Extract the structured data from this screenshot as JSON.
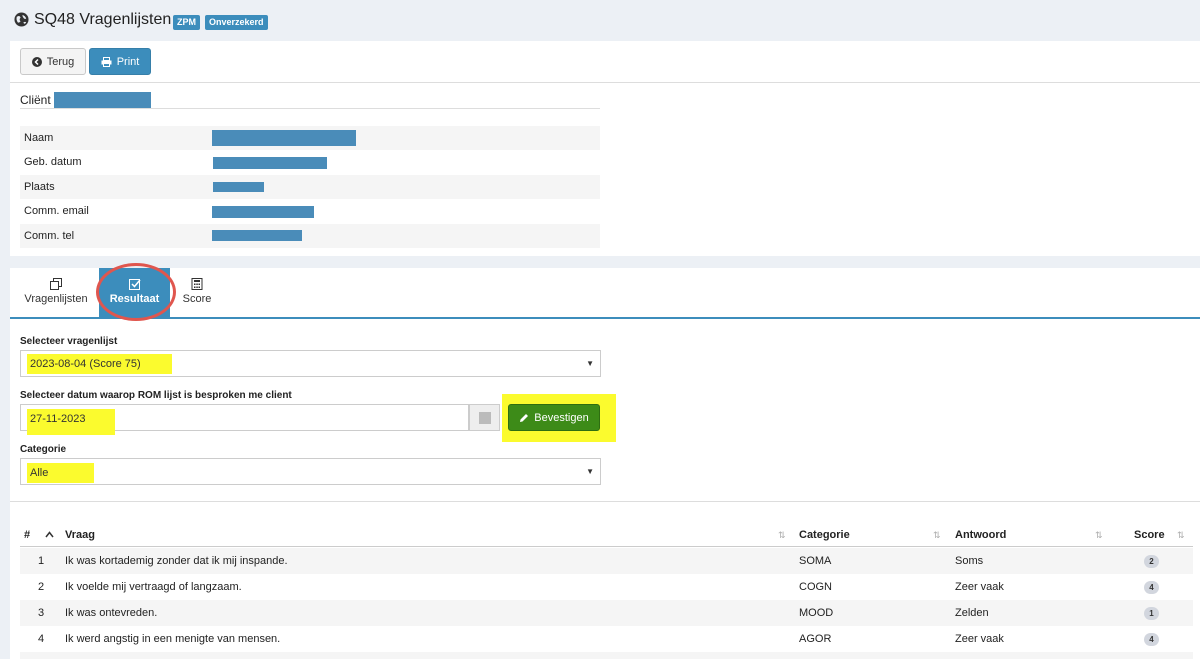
{
  "header": {
    "icon": "globe-icon",
    "title": "SQ48 Vragenlijsten",
    "badges": [
      "ZPM",
      "Onverzekerd"
    ]
  },
  "toolbar": {
    "back_label": "Terug",
    "print_label": "Print"
  },
  "client": {
    "section_label": "Cliënt",
    "fields": [
      {
        "label": "Naam"
      },
      {
        "label": "Geb. datum"
      },
      {
        "label": "Plaats"
      },
      {
        "label": "Comm. email"
      },
      {
        "label": "Comm. tel"
      }
    ]
  },
  "tabs": [
    {
      "label": "Vragenlijsten",
      "icon": "copy-icon"
    },
    {
      "label": "Resultaat",
      "icon": "check-square-icon",
      "active": true
    },
    {
      "label": "Score",
      "icon": "calculator-icon"
    }
  ],
  "form": {
    "questionnaire_label": "Selecteer vragenlijst",
    "questionnaire_value": "2023-08-04 (Score 75)",
    "date_label": "Selecteer datum waarop ROM lijst is besproken me client",
    "date_value": "27-11-2023",
    "confirm_label": "Bevestigen",
    "category_label": "Categorie",
    "category_value": "Alle"
  },
  "table": {
    "headers": [
      "#",
      "Vraag",
      "Categorie",
      "Antwoord",
      "Score"
    ],
    "rows": [
      {
        "num": "1",
        "question": "Ik was kortademig zonder dat ik mij inspande.",
        "category": "SOMA",
        "answer": "Soms",
        "score": "2"
      },
      {
        "num": "2",
        "question": "Ik voelde mij vertraagd of langzaam.",
        "category": "COGN",
        "answer": "Zeer vaak",
        "score": "4"
      },
      {
        "num": "3",
        "question": "Ik was ontevreden.",
        "category": "MOOD",
        "answer": "Zelden",
        "score": "1"
      },
      {
        "num": "4",
        "question": "Ik werd angstig in een menigte van mensen.",
        "category": "AGOR",
        "answer": "Zeer vaak",
        "score": "4"
      }
    ]
  },
  "colors": {
    "primary": "#3c8dbc",
    "success": "#3d8b18",
    "highlight": "#fbfb2e",
    "annotation_ring": "#e0564e"
  }
}
